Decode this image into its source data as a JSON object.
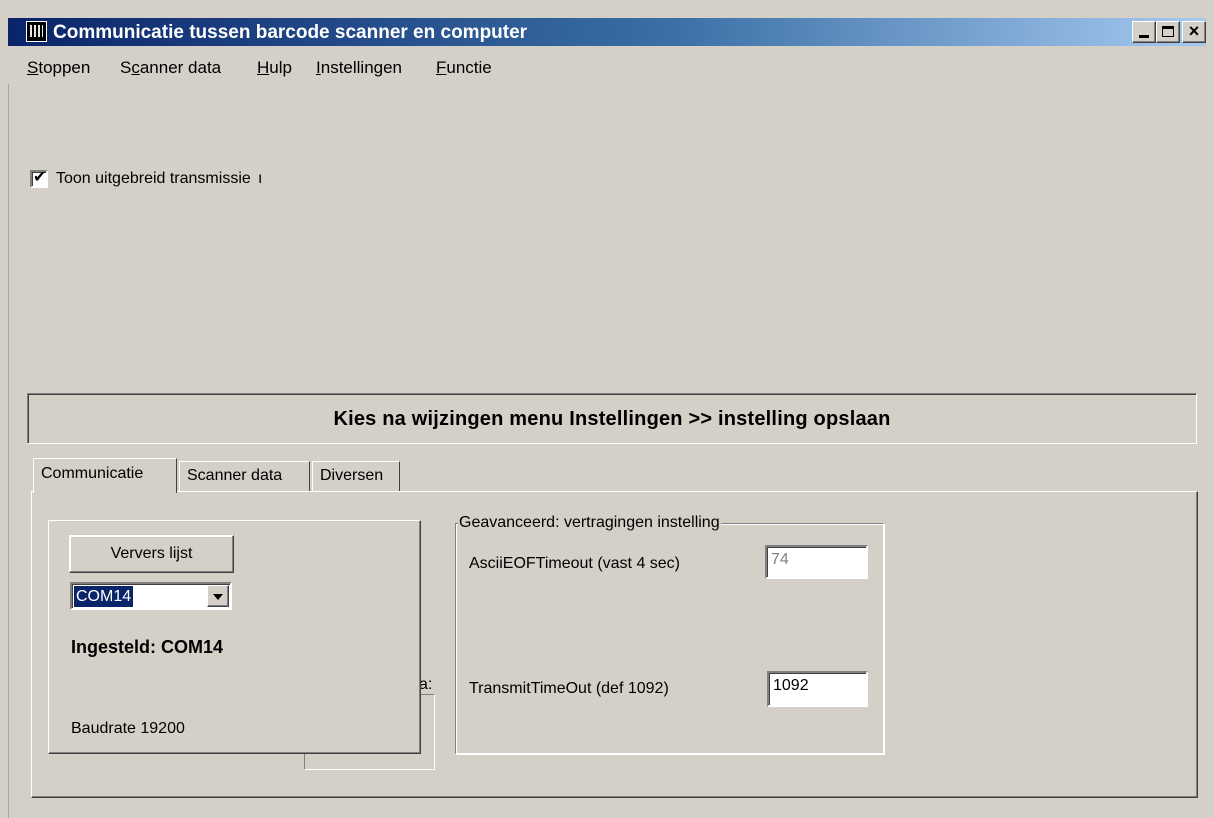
{
  "window": {
    "title": "Communicatie tussen barcode scanner en computer",
    "controls": {
      "minimize": "_",
      "maximize": "□",
      "close": "×"
    }
  },
  "menu": [
    {
      "prefix": "",
      "underline": "S",
      "rest": "toppen"
    },
    {
      "prefix": "S",
      "underline": "c",
      "rest": "anner data"
    },
    {
      "prefix": "",
      "underline": "H",
      "rest": "ulp"
    },
    {
      "prefix": "",
      "underline": "I",
      "rest": "nstellingen"
    },
    {
      "prefix": "",
      "underline": "F",
      "rest": "unctie"
    }
  ],
  "checkbox": {
    "label": "Toon uitgebreid transmissie  ι",
    "checked": true
  },
  "banner": {
    "text": "Kies na wijzingen menu Instellingen >> instelling opslaan"
  },
  "tabs": [
    {
      "label": "Communicatie",
      "active": true
    },
    {
      "label": "Scanner data",
      "active": false
    },
    {
      "label": "Diversen",
      "active": false
    }
  ],
  "port_group": {
    "refresh_button": "Ververs lijst",
    "selected_port": "COM14",
    "configured": "Ingesteld: COM14",
    "baudrate": "Baudrate 19200"
  },
  "partial_label": "a:",
  "advanced_group": {
    "title": "Geavanceerd: vertragingen instelling",
    "ascii_label": "AsciiEOFTimeout (vast 4 sec)",
    "ascii_value": "74",
    "transmit_label": "TransmitTimeOut (def 1092)",
    "transmit_value": "1092"
  }
}
